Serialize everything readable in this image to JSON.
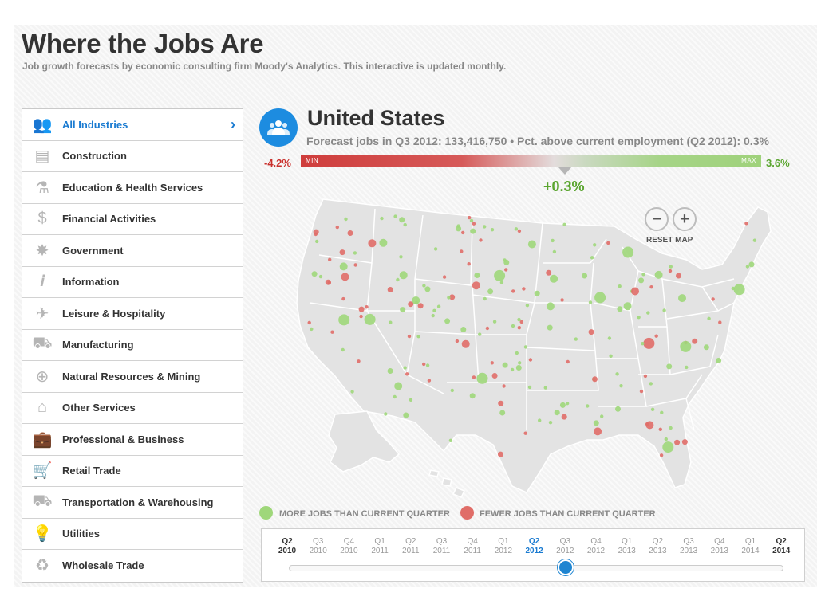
{
  "header": {
    "title": "Where the Jobs Are",
    "subtitle": "Job growth forecasts by economic consulting firm Moody's Analytics. This interactive is updated monthly."
  },
  "sidebar": {
    "items": [
      {
        "label": "All Industries",
        "icon": "people-icon",
        "glyph": "👥",
        "active": true
      },
      {
        "label": "Construction",
        "icon": "brick-wall-icon",
        "glyph": "▤"
      },
      {
        "label": "Education & Health Services",
        "icon": "flask-icon",
        "glyph": "⚗"
      },
      {
        "label": "Financial Activities",
        "icon": "dollar-icon",
        "glyph": "$"
      },
      {
        "label": "Government",
        "icon": "star-icon",
        "glyph": "✸"
      },
      {
        "label": "Information",
        "icon": "info-icon",
        "glyph": "𝒊"
      },
      {
        "label": "Leisure & Hospitality",
        "icon": "airplane-icon",
        "glyph": "✈"
      },
      {
        "label": "Manufacturing",
        "icon": "car-icon",
        "glyph": "⛟"
      },
      {
        "label": "Natural Resources & Mining",
        "icon": "crosshair-icon",
        "glyph": "⊕"
      },
      {
        "label": "Other Services",
        "icon": "house-icon",
        "glyph": "⌂"
      },
      {
        "label": "Professional & Business",
        "icon": "briefcase-icon",
        "glyph": "💼"
      },
      {
        "label": "Retail Trade",
        "icon": "shopping-cart-icon",
        "glyph": "🛒"
      },
      {
        "label": "Transportation & Warehousing",
        "icon": "truck-icon",
        "glyph": "⛟"
      },
      {
        "label": "Utilities",
        "icon": "lightbulb-icon",
        "glyph": "💡"
      },
      {
        "label": "Wholesale Trade",
        "icon": "recycle-icon",
        "glyph": "♻"
      }
    ],
    "chevron": "›"
  },
  "region": {
    "name": "United States",
    "icon": "people-icon",
    "forecast": "Forecast jobs in Q3 2012: 133,416,750 • Pct. above current employment (Q2 2012): 0.3%"
  },
  "scale": {
    "min_label": "-4.2%",
    "max_label": "3.6%",
    "min_tag": "MIN",
    "max_tag": "MAX",
    "current_label": "+0.3%",
    "current_value": 0.3,
    "min_value": -4.2,
    "max_value": 3.6,
    "colors": {
      "negative": "#cf3d3c",
      "positive": "#9fd27b"
    }
  },
  "map": {
    "zoom_out": "−",
    "zoom_in": "+",
    "reset": "RESET MAP",
    "land_color": "#e3e3e3",
    "border_color": "#ffffff",
    "more_color": "#9fd77a",
    "fewer_color": "#e06d68"
  },
  "legend": {
    "more": "MORE JOBS THAN CURRENT QUARTER",
    "fewer": "FEWER JOBS THAN CURRENT QUARTER"
  },
  "timeline": {
    "ticks": [
      {
        "q": "Q2",
        "y": "2010",
        "style": "strong"
      },
      {
        "q": "Q3",
        "y": "2010"
      },
      {
        "q": "Q4",
        "y": "2010"
      },
      {
        "q": "Q1",
        "y": "2011"
      },
      {
        "q": "Q2",
        "y": "2011"
      },
      {
        "q": "Q3",
        "y": "2011"
      },
      {
        "q": "Q4",
        "y": "2011"
      },
      {
        "q": "Q1",
        "y": "2012"
      },
      {
        "q": "Q2",
        "y": "2012",
        "style": "current"
      },
      {
        "q": "Q3",
        "y": "2012"
      },
      {
        "q": "Q4",
        "y": "2012"
      },
      {
        "q": "Q1",
        "y": "2013"
      },
      {
        "q": "Q2",
        "y": "2013"
      },
      {
        "q": "Q3",
        "y": "2013"
      },
      {
        "q": "Q4",
        "y": "2013"
      },
      {
        "q": "Q1",
        "y": "2014"
      },
      {
        "q": "Q2",
        "y": "2014",
        "style": "strong"
      }
    ],
    "selected": "Q3 2012"
  }
}
